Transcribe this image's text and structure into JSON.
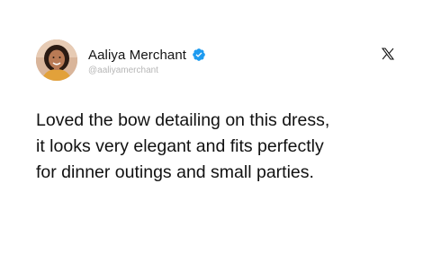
{
  "author": {
    "display_name": "Aaliya Merchant",
    "handle": "@aaliyamerchant",
    "verified": true
  },
  "icons": {
    "avatar": "avatar-photo",
    "verified": "verified-badge-icon",
    "platform": "x-logo-icon"
  },
  "colors": {
    "verified_badge": "#1d9bf0",
    "text": "#111111",
    "handle": "#b6b6b6",
    "background": "#ffffff"
  },
  "tweet": {
    "lines": [
      "Loved the bow detailing on this dress,",
      "it looks very elegant and fits perfectly",
      "for dinner outings and small parties."
    ]
  }
}
